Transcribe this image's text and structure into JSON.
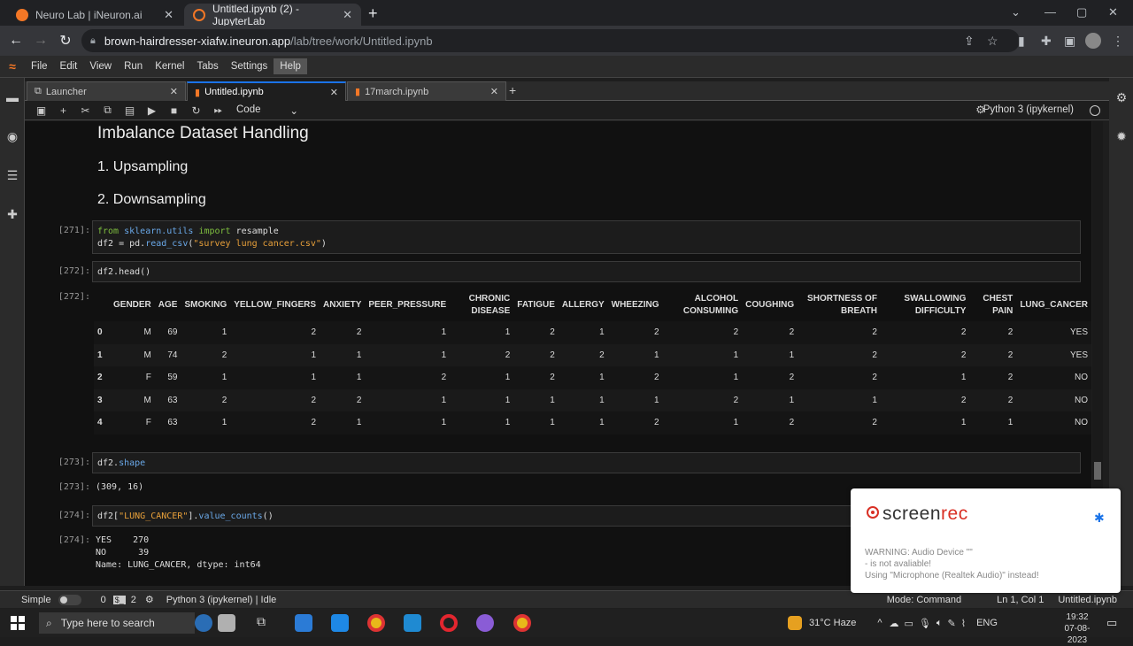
{
  "browser": {
    "tabs": [
      {
        "title": "Neuro Lab | iNeuron.ai"
      },
      {
        "title": "Untitled.ipynb (2) - JupyterLab"
      }
    ],
    "url_host": "brown-hairdresser-xiafw.ineuron.app",
    "url_path": "/lab/tree/work/Untitled.ipynb"
  },
  "menu": [
    "File",
    "Edit",
    "View",
    "Run",
    "Kernel",
    "Tabs",
    "Settings",
    "Help"
  ],
  "doc_tabs": [
    {
      "title": "Launcher"
    },
    {
      "title": "Untitled.ipynb"
    },
    {
      "title": "17march.ipynb"
    }
  ],
  "toolbar": {
    "cell_type": "Code",
    "kernel": "Python 3 (ipykernel)"
  },
  "notebook": {
    "heading1": "Imbalance Dataset Handling",
    "heading2a": "1. Upsampling",
    "heading2b": "2. Downsampling",
    "cells": [
      {
        "prompt": "[271]:"
      },
      {
        "prompt": "[272]:",
        "code": "df2.head()",
        "out_prompt": "[272]:"
      },
      {
        "prompt": "[273]:",
        "out_prompt": "[273]:",
        "output": "(309, 16)"
      },
      {
        "prompt": "[274]:",
        "out_prompt": "[274]:"
      }
    ],
    "code271_line1": {
      "kw1": "from",
      "mod": "sklearn.utils",
      "kw2": "import",
      "name": "resample"
    },
    "code271_line2": {
      "lhs": "df2 = pd.",
      "fn": "read_csv",
      "str": "\"survey lung cancer.csv\""
    },
    "code273": {
      "obj": "df2.",
      "attr": "shape"
    },
    "code274": {
      "obj": "df2[",
      "str": "\"LUNG_CANCER\"",
      "mid": "].",
      "fn": "value_counts",
      "end": "()"
    },
    "output274": "YES    270\nNO      39\nName: LUNG_CANCER, dtype: int64"
  },
  "table": {
    "columns": [
      "",
      "GENDER",
      "AGE",
      "SMOKING",
      "YELLOW_FINGERS",
      "ANXIETY",
      "PEER_PRESSURE",
      "CHRONIC DISEASE",
      "FATIGUE",
      "ALLERGY",
      "WHEEZING",
      "ALCOHOL CONSUMING",
      "COUGHING",
      "SHORTNESS OF BREATH",
      "SWALLOWING DIFFICULTY",
      "CHEST PAIN",
      "LUNG_CANCER"
    ],
    "rows": [
      [
        "0",
        "M",
        "69",
        "1",
        "2",
        "2",
        "1",
        "1",
        "2",
        "1",
        "2",
        "2",
        "2",
        "2",
        "2",
        "2",
        "YES"
      ],
      [
        "1",
        "M",
        "74",
        "2",
        "1",
        "1",
        "1",
        "2",
        "2",
        "2",
        "1",
        "1",
        "1",
        "2",
        "2",
        "2",
        "YES"
      ],
      [
        "2",
        "F",
        "59",
        "1",
        "1",
        "1",
        "2",
        "1",
        "2",
        "1",
        "2",
        "1",
        "2",
        "2",
        "1",
        "2",
        "NO"
      ],
      [
        "3",
        "M",
        "63",
        "2",
        "2",
        "2",
        "1",
        "1",
        "1",
        "1",
        "1",
        "2",
        "1",
        "1",
        "2",
        "2",
        "NO"
      ],
      [
        "4",
        "F",
        "63",
        "1",
        "2",
        "1",
        "1",
        "1",
        "1",
        "1",
        "2",
        "1",
        "2",
        "2",
        "1",
        "1",
        "NO"
      ]
    ]
  },
  "statusbar": {
    "mode_label": "Simple",
    "count1": "0",
    "count2": "2",
    "kernel_status": "Python 3 (ipykernel) | Idle",
    "mode": "Mode: Command",
    "cursor": "Ln 1, Col 1",
    "file": "Untitled.ipynb"
  },
  "screenrec": {
    "brand_a": "screen",
    "brand_b": "rec",
    "warning_l1": "WARNING: Audio Device \"\"",
    "warning_l2": "- is not avaliable!",
    "warning_l3": "Using \"Microphone (Realtek Audio)\" instead!"
  },
  "taskbar": {
    "search_placeholder": "Type here to search",
    "weather": "31°C  Haze",
    "lang": "ENG",
    "time": "19:32",
    "date": "07-08-2023"
  },
  "colors": {
    "accent": "#1a73e8",
    "jupyter_orange": "#f37726"
  }
}
